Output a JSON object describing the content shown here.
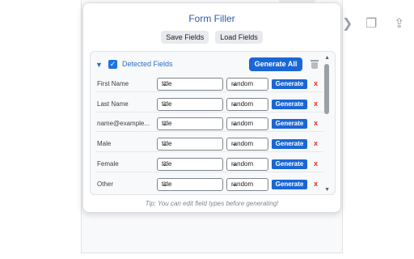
{
  "popup": {
    "title": "Form Filler",
    "save_label": "Save Fields",
    "load_label": "Load Fields"
  },
  "panel": {
    "detected_label": "Detected Fields",
    "generate_all_label": "Generate All",
    "checkbox_checked": true
  },
  "rows": [
    {
      "label": "First Name",
      "type": "title",
      "mode": "random",
      "generate": "Generate",
      "delete": "x"
    },
    {
      "label": "Last Name",
      "type": "title",
      "mode": "random",
      "generate": "Generate",
      "delete": "x"
    },
    {
      "label": "name@example...",
      "type": "title",
      "mode": "random",
      "generate": "Generate",
      "delete": "x"
    },
    {
      "label": "Male",
      "type": "title",
      "mode": "random",
      "generate": "Generate",
      "delete": "x"
    },
    {
      "label": "Female",
      "type": "title",
      "mode": "random",
      "generate": "Generate",
      "delete": "x"
    },
    {
      "label": "Other",
      "type": "title",
      "mode": "random",
      "generate": "Generate",
      "delete": "x"
    }
  ],
  "tip": "Tip: You can edit field types before generating!",
  "colors": {
    "accent": "#1a66d6",
    "title": "#2b5aa8",
    "delete": "#d93025"
  },
  "icons": {
    "caret": "caret-down-icon",
    "trash": "trash-icon",
    "checkbox": "checkbox-icon"
  }
}
